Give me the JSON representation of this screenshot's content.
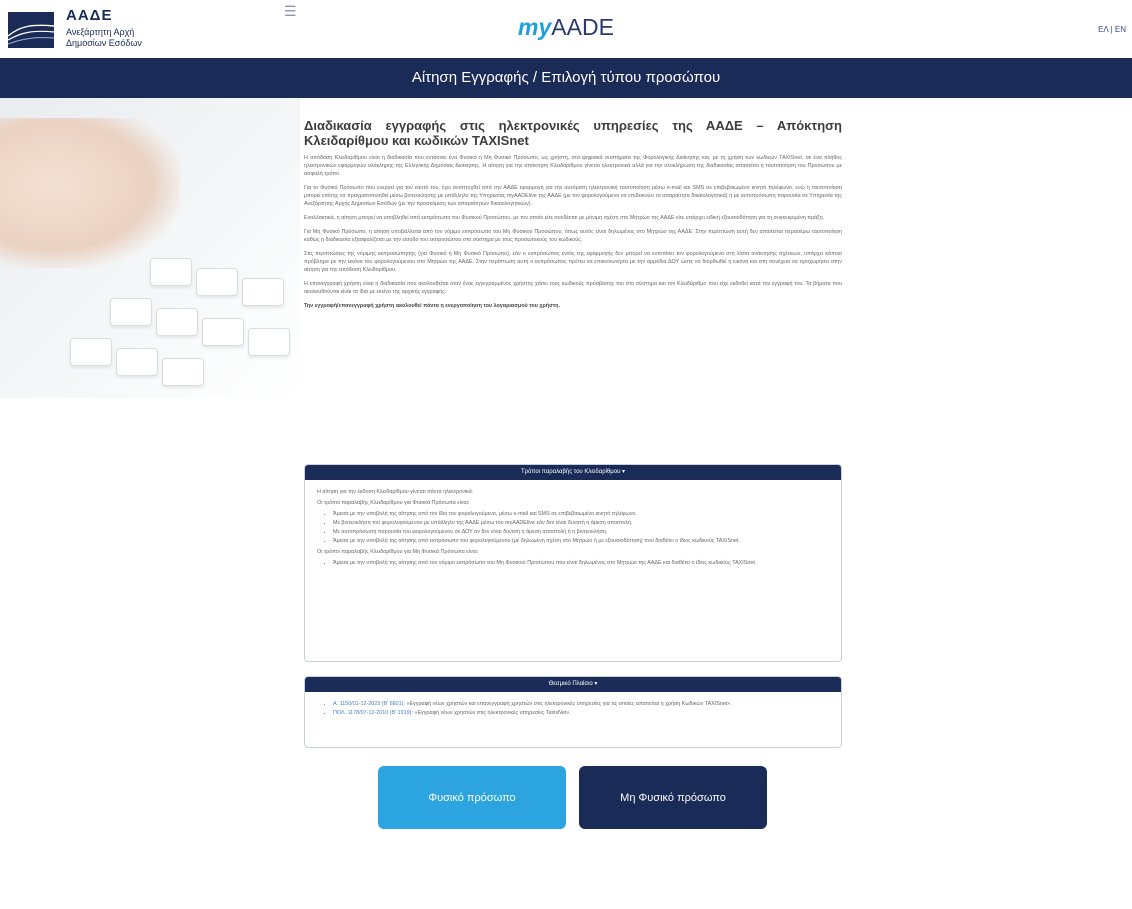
{
  "header": {
    "logo_title": "ΑΑΔΕ",
    "logo_subtitle": "Ανεξάρτητη Αρχή Δημοσίων Εσόδων",
    "brand_my": "my",
    "brand_aade": "AADE",
    "lang_el": "ΕΛ",
    "lang_sep": " | ",
    "lang_en": "EN"
  },
  "titlebar": {
    "title": "Αίτηση Εγγραφής / Επιλογή τύπου προσώπου"
  },
  "main": {
    "heading": "Διαδικασία εγγραφής στις ηλεκτρονικές υπηρεσίες της ΑΑΔΕ – Απόκτηση Κλειδαρίθμου και κωδικών TAXISnet",
    "paragraphs": [
      "Η απόδοση Κλειδαρίθμου είναι η διαδικασία που εντάσσει ένα Φυσικό ή Μη Φυσικό Πρόσωπο, ως χρήστη, στα ψηφιακά συστήματα της Φορολογικής Διοίκησης και, με τη χρήση των κωδικών TAXISnet, σε ένα πλήθος ηλεκτρονικών εφαρμογών ολόκληρης της Ελληνικής Δημόσιας Διοίκησης. Η αίτηση για την απόκτηση Κλειδαρίθμου γίνεται ηλεκτρονικά αλλά για την ολοκλήρωση της διαδικασίας απαιτείται η ταυτοποίηση του Προσώπου με ασφαλή τρόπο.",
      "Για το Φυσικό Πρόσωπο που ενεργεί για τον εαυτό του, έχει αναπτυχθεί από την ΑΑΔΕ εφαρμογή για την αυτόματη ηλεκτρονική ταυτοποίηση μέσω e-mail και SMS σε επιβεβαιωμένο κινητό τηλέφωνο, ενώ η ταυτοποίηση μπορεί επίσης να πραγματοποιηθεί μέσω βιντεοκλήσης με υπάλληλο της Υπηρεσίας myAADElive της ΑΑΔΕ (με τον φορολογούμενο να επιδεικνύει τα απαραίτητα δικαιολογητικά) ή με αυτοπρόσωπη παρουσία σε Υπηρεσία της Ανεξάρτητης Αρχής Δημοσίων Εσόδων (με την προσκόμιση των απαραίτητων δικαιολογητικών).",
      "Εναλλακτικά, η αίτηση μπορεί να υποβληθεί από εκπρόσωπο του Φυσικού Προσώπου, με τον οποίο είτε συνδέεται με μόνιμη σχέση στο Μητρώο της ΑΑΔΕ είτε υπάρχει ειδική εξουσιοδότηση για τη συγκεκριμένη πράξη.",
      "Για Μη Φυσικό Πρόσωπο, η αίτηση υποβάλλεται από τον νόμιμο εκπρόσωπο του Μη Φυσικού Προσώπου, όπως αυτός είναι δηλωμένος στο Μητρώο της ΑΑΔΕ. Στην περίπτωση αυτή δεν απαιτείται περαιτέρω ταυτοποίηση καθώς η διαδικασία εξασφαλίζεται με την είσοδο του εκπροσώπου στο σύστημα με τους προσωπικούς του κωδικούς.",
      "Στις περιπτώσεις της νόμιμης εκπροσώπησης (για Φυσικό ή Μη Φυσικό Πρόσωπο), εάν ο εκπρόσωπος εντός της εφαρμογής δεν μπορεί να εντοπίσει τον φορολογούμενο στη λίστα ανάκτησης σχέσεων, υπάρχει κάποιο πρόβλημα με την εικόνα του φορολογούμενου στο Μητρώο της ΑΑΔΕ. Στην περίπτωση αυτή ο εκπρόσωπος πρέπει να επικοινωνήσει με την αρμόδια ΔΟΥ ώστε να διορθωθεί η εικόνα και στη συνέχεια να προχωρήσει στην αίτηση για την απόδοση Κλειδαρίθμου.",
      "Η επανεγγραφή χρήστη είναι η διαδικασία που ακολουθείται όταν ένας εγγεγραμμένος χρήστης χάσει τους κωδικούς πρόσβασης του στο σύστημα και τον Κλειδάριθμο που είχε εκδοθεί κατά την εγγραφή του. Τα βήματα που ακολουθούνται είναι τα ίδια με εκείνα της αρχικής εγγραφής.",
      "Την εγγραφή/επανεγγραφή χρήστη ακολουθεί πάντα η ενεργοποίηση του λογαριασμού του χρήστη."
    ]
  },
  "panel_receipt": {
    "header": "Τρόποι παραλαβής του Κλειδαρίθμου",
    "intro": "Η αίτηση για την έκδοση Κλειδαρίθμου γίνεται πάντα ηλεκτρονικά.",
    "fp_lead": "Οι τρόποι παραλαβής Κλειδαρίθμου για Φυσικά Πρόσωπα είναι:",
    "fp_items": [
      "Άμεσα με την υποβολή της αίτησης από τον ίδιο τον φορολογούμενο, μέσω e-mail και SMS σε επιβεβαιωμένο κινητό τηλέφωνο.",
      "Με βιντεοκλήση του φορολογούμενου με υπάλληλο της ΑΑΔΕ μέσω του myAADElive εάν δεν είναι δυνατή η άμεση αποστολή.",
      "Με αυτοπρόσωπη παρουσία του φορολογούμενου σε ΔΟΥ αν δεν είναι δυνατή η άμεση αποστολή ή η βιντεοκλήση.",
      "Άμεσα με την υποβολή της αίτησης από εκπρόσωπο του φορολογούμενου (με δηλωμένη σχέση στο Μητρώο ή με εξουσιοδότηση) που διαθέτει ο ίδιος κωδικούς TAXISnet."
    ],
    "mfp_lead": "Οι τρόποι παραλαβής Κλειδαρίθμου για Μη Φυσικά Πρόσωπα είναι:",
    "mfp_items": [
      "Άμεσα με την υποβολή της αίτησης από τον νόμιμο εκπρόσωπο του Μη Φυσικού Προσώπου που είναι δηλωμένος στο Μητρώο της ΑΑΔΕ και διαθέτει ο ίδιος κωδικούς TAXISnet."
    ]
  },
  "panel_legal": {
    "header": "Θεσμικό Πλαίσιο",
    "items": [
      {
        "ref": "Α. 1150/01-12-2023 (Β' 6801)",
        "text": ": «Εγγραφή νέων χρηστών και επανεγγραφή χρηστών στις ηλεκτρονικές υπηρεσίες για τις οποίες απαιτείται η χρήση Κωδικών TAXISnet»."
      },
      {
        "ref": "ΠΟΛ. 1178/07-12-2010 (Β' 1919)",
        "text": ": «Εγγραφή νέων χρηστών στις ηλεκτρονικές υπηρεσίες TaxisNet»."
      }
    ]
  },
  "buttons": {
    "natural_person": "Φυσικό πρόσωπο",
    "legal_person": "Μη Φυσικό πρόσωπο"
  },
  "colors": {
    "navy": "#1a2b57",
    "light_blue": "#2ba4e0"
  }
}
